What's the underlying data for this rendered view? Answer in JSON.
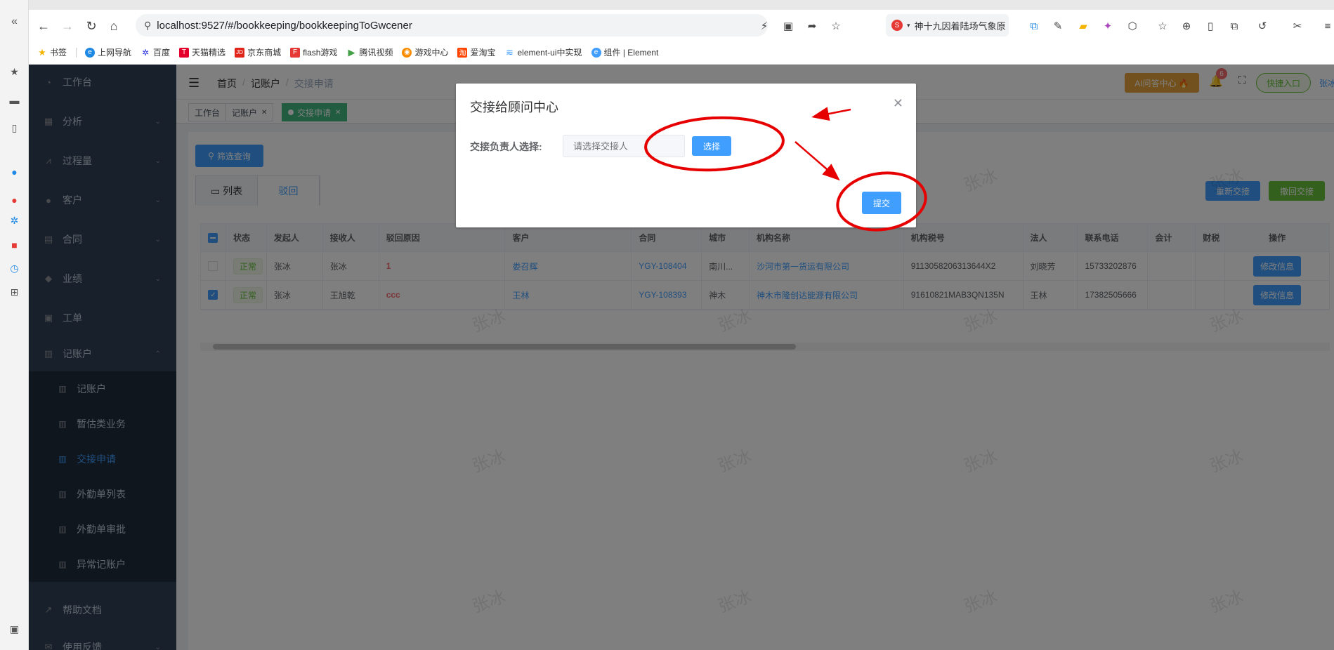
{
  "browser": {
    "url": "localhost:9527/#/bookkeeping/bookkeepingToGwcener",
    "search_suggestion": "神十九因着陆场气象原",
    "bookmarks": [
      {
        "label": "书签",
        "color": "#f5b400",
        "icon": "star-icon"
      },
      {
        "label": "上网导航",
        "color": "#1e88e5",
        "icon": "e-icon"
      },
      {
        "label": "百度",
        "color": "#2932e1",
        "icon": "paw-icon"
      },
      {
        "label": "天猫精选",
        "color": "#e4002b",
        "icon": "t-icon"
      },
      {
        "label": "京东商城",
        "color": "#e1251b",
        "icon": "jd-icon"
      },
      {
        "label": "flash游戏",
        "color": "#e53935",
        "icon": "f-icon"
      },
      {
        "label": "腾讯视频",
        "color": "#43a047",
        "icon": "play-icon"
      },
      {
        "label": "游戏中心",
        "color": "#fb8c00",
        "icon": "gamepad-icon"
      },
      {
        "label": "爱淘宝",
        "color": "#ff4400",
        "icon": "taobao-icon"
      },
      {
        "label": "element-ui中实现",
        "color": "#409eff",
        "icon": "layers-icon"
      },
      {
        "label": "组件 | Element",
        "color": "#409eff",
        "icon": "element-icon"
      }
    ]
  },
  "sidebar": {
    "items": [
      {
        "label": "工作台",
        "icon": "dashboard-icon"
      },
      {
        "label": "分析",
        "icon": "chart-icon"
      },
      {
        "label": "过程量",
        "icon": "process-icon"
      },
      {
        "label": "客户",
        "icon": "user-icon"
      },
      {
        "label": "合同",
        "icon": "contract-icon"
      },
      {
        "label": "业绩",
        "icon": "performance-icon"
      },
      {
        "label": "工单",
        "icon": "ticket-icon"
      },
      {
        "label": "记账户",
        "icon": "ledger-icon"
      }
    ],
    "sub_items": [
      {
        "label": "记账户"
      },
      {
        "label": "暂估类业务"
      },
      {
        "label": "交接申请"
      },
      {
        "label": "外勤单列表"
      },
      {
        "label": "外勤单审批"
      },
      {
        "label": "异常记账户"
      }
    ],
    "help": "帮助文档",
    "feedback": "使用反馈"
  },
  "header": {
    "breadcrumb": [
      "首页",
      "记账户",
      "交接申请"
    ],
    "ai_button": "AI问答中心 🔥",
    "notification_count": "6",
    "quick_entry": "快捷入口",
    "user": "张冰"
  },
  "tags": [
    {
      "label": "工作台"
    },
    {
      "label": "记账户"
    },
    {
      "label": "交接申请"
    }
  ],
  "page": {
    "filter_button": "筛选查询",
    "tabs": [
      "列表",
      "驳回"
    ],
    "redo_button": "重新交接",
    "recall_button": "撤回交接"
  },
  "table": {
    "headers": [
      "状态",
      "发起人",
      "接收人",
      "驳回原因",
      "客户",
      "合同",
      "城市",
      "机构名称",
      "机构税号",
      "法人",
      "联系电话",
      "会计",
      "财税",
      "操作"
    ],
    "rows": [
      {
        "status": "正常",
        "initiator": "张冰",
        "receiver": "张冰",
        "reason": "1",
        "customer": "娄召辉",
        "contract": "YGY-108404",
        "city": "南川...",
        "org": "沙河市第一货运有限公司",
        "tax_id": "9113058206313644X2",
        "legal": "刘晓芳",
        "phone": "15733202876",
        "accountant": "",
        "finance": "",
        "action": "修改信息",
        "checked": false
      },
      {
        "status": "正常",
        "initiator": "张冰",
        "receiver": "王旭乾",
        "reason": "ccc",
        "customer": "王林",
        "contract": "YGY-108393",
        "city": "神木",
        "org": "神木市隆创达能源有限公司",
        "tax_id": "91610821MAB3QN135N",
        "legal": "王林",
        "phone": "17382505666",
        "accountant": "",
        "finance": "",
        "action": "修改信息",
        "checked": true
      }
    ]
  },
  "watermark": "张冰",
  "dialog": {
    "title": "交接给顾问中心",
    "label": "交接负责人选择:",
    "placeholder": "请选择交接人",
    "select_button": "选择",
    "submit_button": "提交"
  },
  "colors": {
    "primary": "#409eff",
    "success": "#67c23a",
    "sidebar_bg": "#304156",
    "annotation": "#e60000"
  }
}
